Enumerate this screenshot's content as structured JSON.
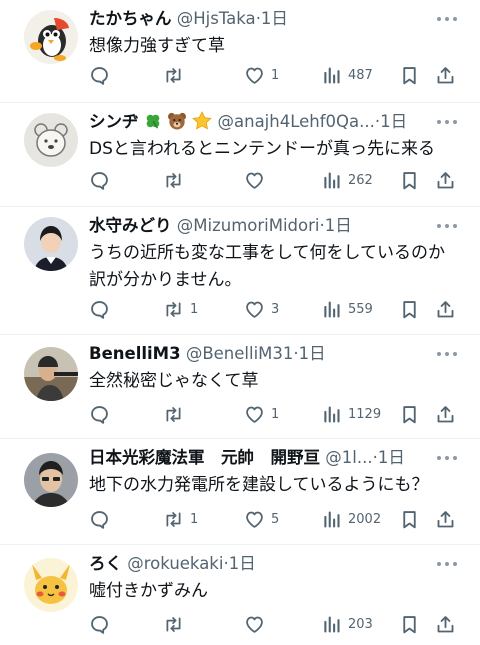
{
  "tweets": [
    {
      "name": "たかちゃん",
      "handle": "@HjsTaka",
      "time": "·1日",
      "text": "想像力強すぎて草",
      "replies": "",
      "retweets": "",
      "likes": "1",
      "views": "487"
    },
    {
      "name": "シンヂ",
      "handle": "@anajh4Lehf0Qa...",
      "time": "·1日",
      "text": "DSと言われるとニンテンドーが真っ先に来る",
      "replies": "",
      "retweets": "",
      "likes": "",
      "views": "262",
      "emojis": [
        "clover-emoji",
        "bear-face-emoji",
        "star-emoji"
      ]
    },
    {
      "name": "水守みどり",
      "handle": "@MizumoriMidori",
      "time": "·1日",
      "text_lines": [
        "うちの近所も変な工事をして何をしているのか",
        "訳が分かりません。"
      ],
      "replies": "",
      "retweets": "1",
      "likes": "3",
      "views": "559"
    },
    {
      "name": "BenelliM3",
      "handle": "@BenelliM31",
      "time": "·1日",
      "text": "全然秘密じゃなくて草",
      "replies": "",
      "retweets": "",
      "likes": "1",
      "views": "1129"
    },
    {
      "name": "日本光彩魔法軍　元帥　開野亘",
      "handle": "@1l...",
      "time": "·1日",
      "text": "地下の水力発電所を建設しているようにも？",
      "replies": "",
      "retweets": "1",
      "likes": "5",
      "views": "2002"
    },
    {
      "name": "ろく",
      "handle": "@rokuekaki",
      "time": "·1日",
      "text": "嘘付きかずみん",
      "replies": "",
      "retweets": "",
      "likes": "",
      "views": "203"
    }
  ],
  "colors": {
    "text": "#0f1419",
    "secondary": "#536471",
    "divider": "#eff3f4"
  },
  "icons": [
    "reply-icon",
    "retweet-icon",
    "like-icon",
    "views-icon",
    "bookmark-icon",
    "share-icon",
    "more-icon"
  ]
}
